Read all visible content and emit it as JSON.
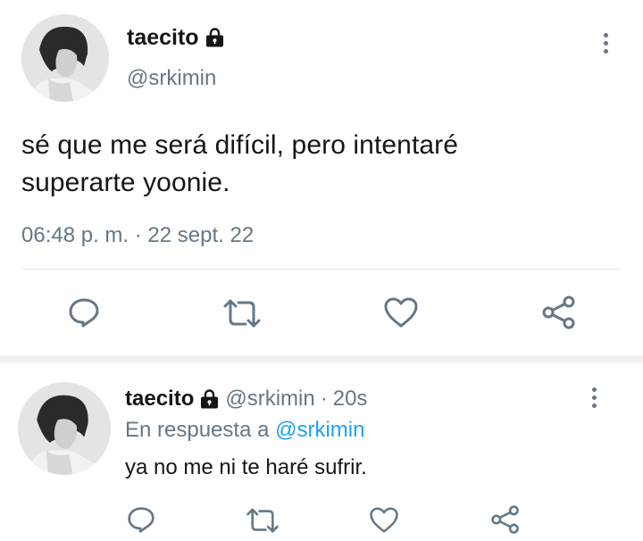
{
  "tweet": {
    "display_name": "taecito",
    "handle": "@srkimin",
    "text_line1": "sé que me será difícil, pero intentaré",
    "text_line2": "superarte yoonie.",
    "time": "06:48 p. m.",
    "separator": "·",
    "date": "22 sept. 22",
    "actions": [
      "reply-icon",
      "retweet-icon",
      "like-icon",
      "share-icon"
    ],
    "locked_icon": "lock-icon",
    "menu_icon": "more-vertical-icon"
  },
  "reply": {
    "display_name": "taecito",
    "handle": "@srkimin",
    "separator": "·",
    "age": "20s",
    "replying_prefix": "En respuesta a",
    "replying_to": "@srkimin",
    "text": "ya no me ni te haré sufrir.",
    "actions": [
      "reply-icon",
      "retweet-icon",
      "like-icon",
      "share-icon"
    ],
    "locked_icon": "lock-icon",
    "menu_icon": "more-vertical-icon"
  },
  "colors": {
    "text": "#14171a",
    "muted": "#657786",
    "link": "#1da1f2",
    "divider": "#e6ecf0"
  }
}
